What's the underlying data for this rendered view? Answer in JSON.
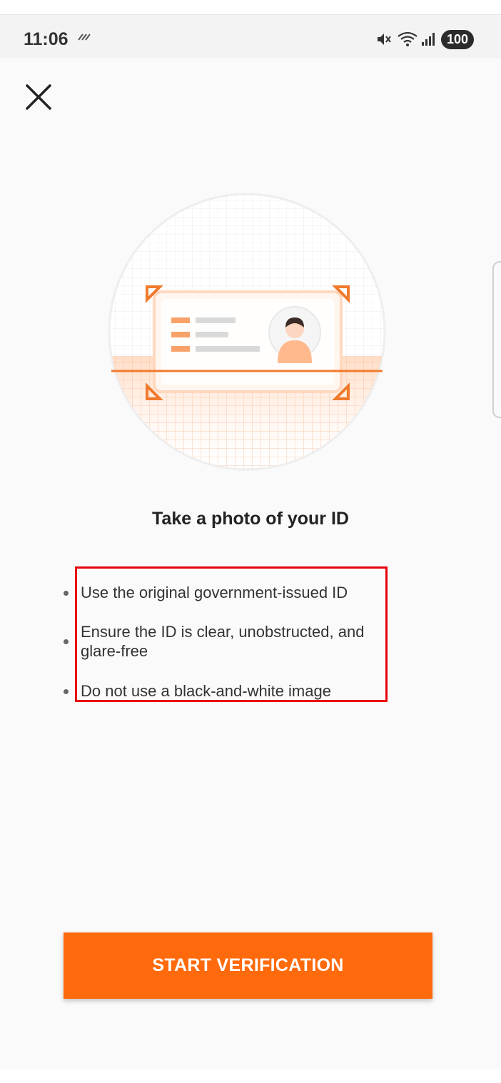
{
  "status_bar": {
    "time": "11:06",
    "battery": "100",
    "icons": [
      "signal-glyph-icon",
      "mute-icon",
      "wifi-icon",
      "cell-signal-icon",
      "battery-icon"
    ]
  },
  "header": {
    "close_icon": "close-icon"
  },
  "main": {
    "title": "Take a photo of your ID",
    "tips": [
      "Use the original government-issued ID",
      "Ensure the ID is clear, unobstructed, and glare-free",
      "Do not use a black-and-white image"
    ]
  },
  "footer": {
    "cta_label": "START VERIFICATION"
  },
  "colors": {
    "accent": "#ff6a0d",
    "highlight": "#e8000d",
    "background": "#fafafa"
  }
}
